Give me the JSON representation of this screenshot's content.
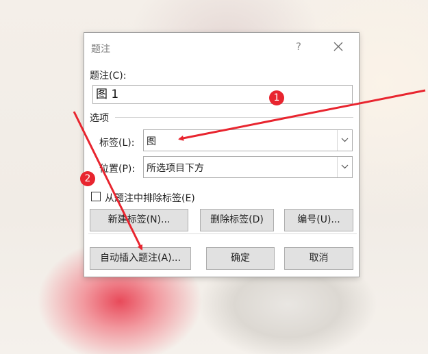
{
  "dialog": {
    "title": "题注",
    "help_glyph": "?",
    "close_glyph": "✕",
    "caption_label": "题注(C):",
    "caption_value": "图  1",
    "options_group": "选项",
    "label_label": "标签(L):",
    "label_value": "图",
    "position_label": "位置(P):",
    "position_value": "所选项目下方",
    "exclude_label": "从题注中排除标签(E)",
    "exclude_checked": false,
    "new_label_button": "新建标签(N)...",
    "delete_label_button": "删除标签(D)",
    "numbering_button": "编号(U)...",
    "autocaption_button": "自动插入题注(A)...",
    "ok_button": "确定",
    "cancel_button": "取消"
  },
  "annotations": {
    "marker_1": "1",
    "marker_2": "2",
    "arrow_color": "#e8252f"
  },
  "colors": {
    "dialog_bg": "#ffffff",
    "button_bg": "#e1e1e1",
    "border": "#adadad",
    "marker": "#e8252f"
  }
}
